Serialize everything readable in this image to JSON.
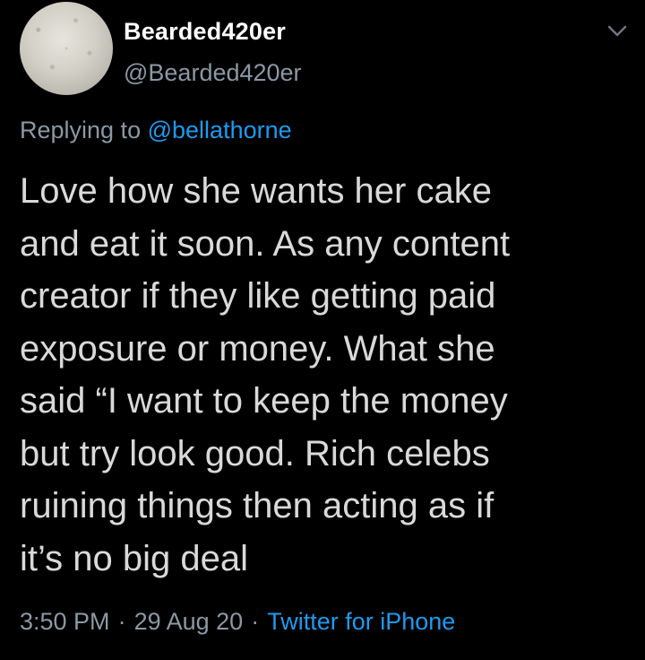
{
  "user": {
    "display_name": "Bearded420er",
    "handle": "@Bearded420er",
    "avatar": "textured-wall-avatar"
  },
  "reply": {
    "prefix": "Replying to",
    "mention": "@bellathorne"
  },
  "tweet": {
    "lines": [
      "Love how she wants her cake",
      "and eat it soon. As any content",
      "creator if they like getting paid",
      "exposure or money. What she",
      "said “I want to keep the money",
      "but try look good. Rich celebs",
      "ruining things then acting as if",
      "it’s no big deal"
    ]
  },
  "meta": {
    "time": "3:50 PM",
    "separator": "·",
    "date": "29 Aug 20",
    "source": "Twitter for iPhone"
  },
  "icons": {
    "menu": "chevron-down-icon"
  },
  "colors": {
    "background": "#000000",
    "text": "#d9d9d9",
    "secondary": "#8b98a5",
    "link": "#1d9bf0"
  }
}
